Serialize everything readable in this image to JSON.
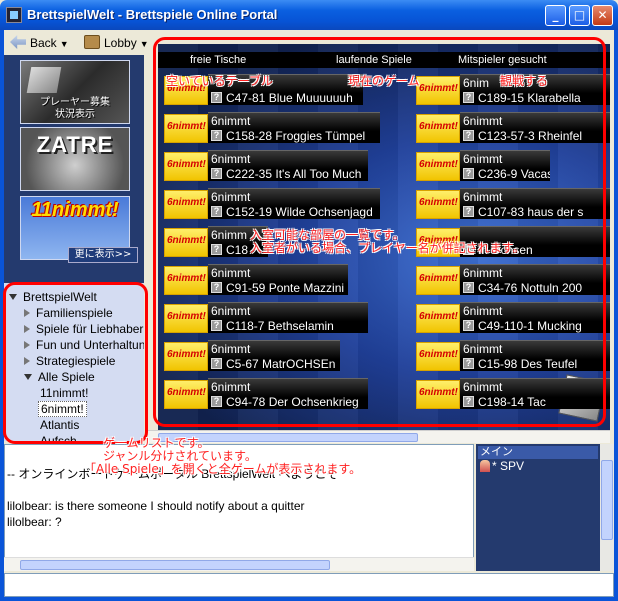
{
  "window": {
    "title": "BrettspielWelt - Brettspiele Online Portal",
    "controls": {
      "minimize": "_",
      "maximize": "□",
      "close": "✕"
    }
  },
  "toolbar": {
    "back_label": "Back",
    "lobby_label": "Lobby"
  },
  "left_panel": {
    "recruit_banner": "プレーヤー募集\n状況表示",
    "zatre_banner": "ZATRE",
    "nimmt_banner": "11nimmt!",
    "more_button": "更に表示>>"
  },
  "tree": {
    "root": "BrettspielWelt",
    "items": [
      {
        "label": "Familienspiele",
        "state": "collapsed"
      },
      {
        "label": "Spiele für Liebhaber",
        "state": "collapsed"
      },
      {
        "label": "Fun und Unterhaltung",
        "state": "collapsed"
      },
      {
        "label": "Strategiespiele",
        "state": "collapsed"
      },
      {
        "label": "Alle Spiele",
        "state": "expanded"
      }
    ],
    "children": [
      "11nimmt!",
      "6nimmt!",
      "Atlantis",
      "Aufsch..."
    ],
    "selected": "6nimmt!"
  },
  "tabs": [
    "freie Tische",
    "laufende Spiele",
    "Mitspieler gesucht"
  ],
  "games_left": [
    {
      "name": "",
      "room": "C47-81 Blue Muuuuuuh"
    },
    {
      "name": "6nimmt",
      "room": "C158-28 Froggies Tümpel"
    },
    {
      "name": "6nimmt",
      "room": "C222-35 It's All Too Much"
    },
    {
      "name": "6nimmt",
      "room": "C152-19 Wilde Ochsenjagd"
    },
    {
      "name": "6nimm",
      "room": "C18"
    },
    {
      "name": "6nimmt",
      "room": "C91-59 Ponte Mazzini"
    },
    {
      "name": "6nimmt",
      "room": "C118-7 Bethselamin"
    },
    {
      "name": "6nimmt",
      "room": "C5-67 MatrOCHSEn"
    },
    {
      "name": "6nimmt",
      "room": "C94-78 Der Ochsenkrieg"
    }
  ],
  "games_right": [
    {
      "name": "6nim",
      "room": "C189-15 Klarabella"
    },
    {
      "name": "6nimmt",
      "room": "C123-57-3 Rheinfel"
    },
    {
      "name": "6nimmt",
      "room": "C236-9 Vacas"
    },
    {
      "name": "6nimmt",
      "room": "C107-83 haus der s"
    },
    {
      "name": "",
      "room": "m Ochsen"
    },
    {
      "name": "6nimmt",
      "room": "C34-76 Nottuln 200"
    },
    {
      "name": "6nimmt",
      "room": "C49-110-1 Mucking"
    },
    {
      "name": "6nimmt",
      "room": "C15-98 Des Teufel"
    },
    {
      "name": "6nimmt",
      "room": "C198-14 Tac"
    }
  ],
  "logo_text": "6nimmt!",
  "annotations": {
    "free_tables": "空いているテーブル",
    "current_game": "現在のゲーム",
    "watch": "観戦する",
    "rooms_line1": "入室可能な部屋の一覧です。",
    "rooms_line2": "入室者がいる場合、プレイヤー名が併記されます。",
    "tree_line1": "ゲームリストです。",
    "tree_line2": "ジャンル分けされています。",
    "tree_line3": "「Alle Spiele」を開くと全ゲームが表示されます。"
  },
  "chat": {
    "line1": "-- オンラインボードゲームポータル BrettspielWelt へようこそ",
    "line2": "lilolbear: is there someone I should notify about a quitter",
    "line3": "lilolbear: ?"
  },
  "users": {
    "header": "メイン",
    "user": "* SPV"
  },
  "input": {
    "value": ""
  }
}
